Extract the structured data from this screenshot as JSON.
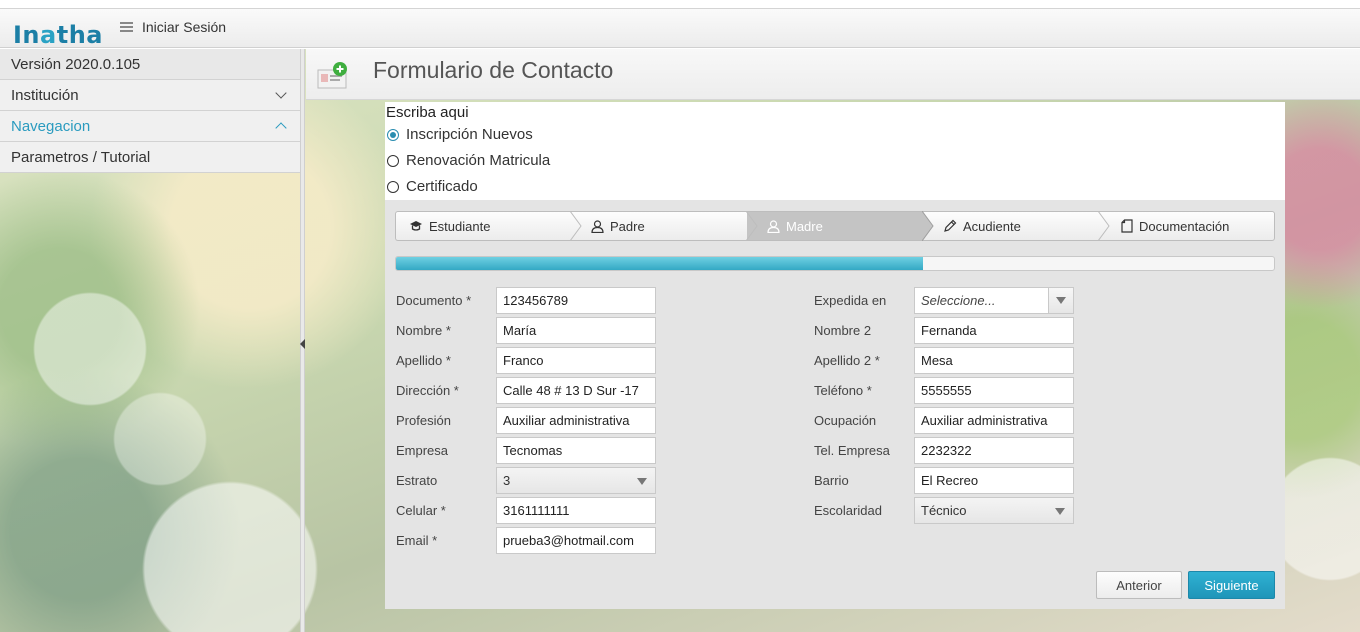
{
  "header": {
    "logo": "Inatha",
    "login_label": "Iniciar Sesión"
  },
  "sidebar": {
    "version": "Versión 2020.0.105",
    "items": [
      {
        "label": "Institución",
        "state": "collapsed"
      },
      {
        "label": "Navegacion",
        "state": "expanded"
      },
      {
        "label": "Parametros / Tutorial"
      }
    ]
  },
  "page": {
    "title": "Formulario de Contacto"
  },
  "form": {
    "prompt": "Escriba aqui",
    "options": [
      {
        "label": "Inscripción Nuevos",
        "checked": true
      },
      {
        "label": "Renovación Matricula",
        "checked": false
      },
      {
        "label": "Certificado",
        "checked": false
      }
    ],
    "steps": [
      {
        "label": "Estudiante",
        "icon": "graduation-cap-icon"
      },
      {
        "label": "Padre",
        "icon": "user-icon"
      },
      {
        "label": "Madre",
        "icon": "user-icon",
        "active": true
      },
      {
        "label": "Acudiente",
        "icon": "pencil-icon"
      },
      {
        "label": "Documentación",
        "icon": "document-icon"
      }
    ],
    "progress": 0.6,
    "left_fields": [
      {
        "label": "Documento *",
        "value": "123456789"
      },
      {
        "label": "Nombre *",
        "value": "María"
      },
      {
        "label": "Apellido *",
        "value": "Franco"
      },
      {
        "label": "Dirección *",
        "value": "Calle 48 # 13 D Sur -17"
      },
      {
        "label": "Profesión",
        "value": "Auxiliar administrativa"
      },
      {
        "label": "Empresa",
        "value": "Tecnomas"
      },
      {
        "label": "Estrato",
        "value": "3"
      },
      {
        "label": "Celular *",
        "value": "3161111111"
      },
      {
        "label": "Email *",
        "value": "prueba3@hotmail.com"
      }
    ],
    "right_fields": [
      {
        "label": "Expedida en",
        "placeholder": "Seleccione..."
      },
      {
        "label": "Nombre 2",
        "value": "Fernanda"
      },
      {
        "label": "Apellido 2 *",
        "value": "Mesa"
      },
      {
        "label": "Teléfono *",
        "value": "5555555"
      },
      {
        "label": "Ocupación",
        "value": "Auxiliar administrativa"
      },
      {
        "label": "Tel. Empresa",
        "value": "2232322"
      },
      {
        "label": "Barrio",
        "value": "El Recreo"
      },
      {
        "label": "Escolaridad",
        "value": "Técnico"
      }
    ],
    "buttons": {
      "previous": "Anterior",
      "next": "Siguiente"
    }
  },
  "colors": {
    "accent": "#1e95b9",
    "progress": "#34a8c4",
    "link_active": "#2a9bbf"
  }
}
